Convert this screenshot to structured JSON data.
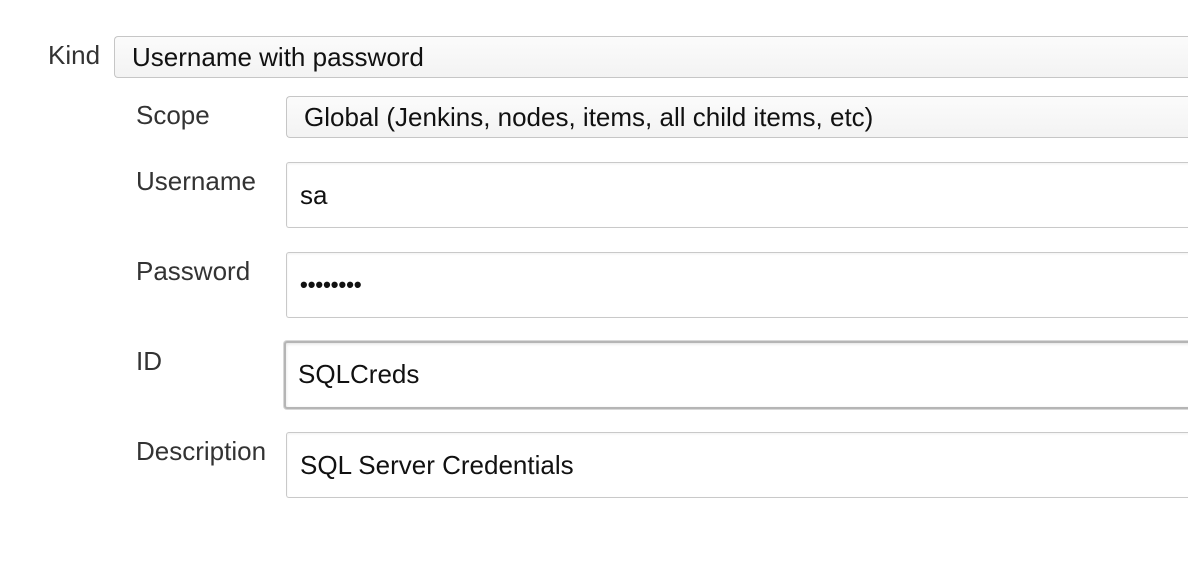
{
  "kind": {
    "label": "Kind",
    "selected": "Username with password"
  },
  "scope": {
    "label": "Scope",
    "selected": "Global (Jenkins, nodes, items, all child items, etc)"
  },
  "username": {
    "label": "Username",
    "value": "sa"
  },
  "password": {
    "label": "Password",
    "value": "••••••••"
  },
  "id": {
    "label": "ID",
    "value": "SQLCreds"
  },
  "description": {
    "label": "Description",
    "value": "SQL Server Credentials"
  }
}
